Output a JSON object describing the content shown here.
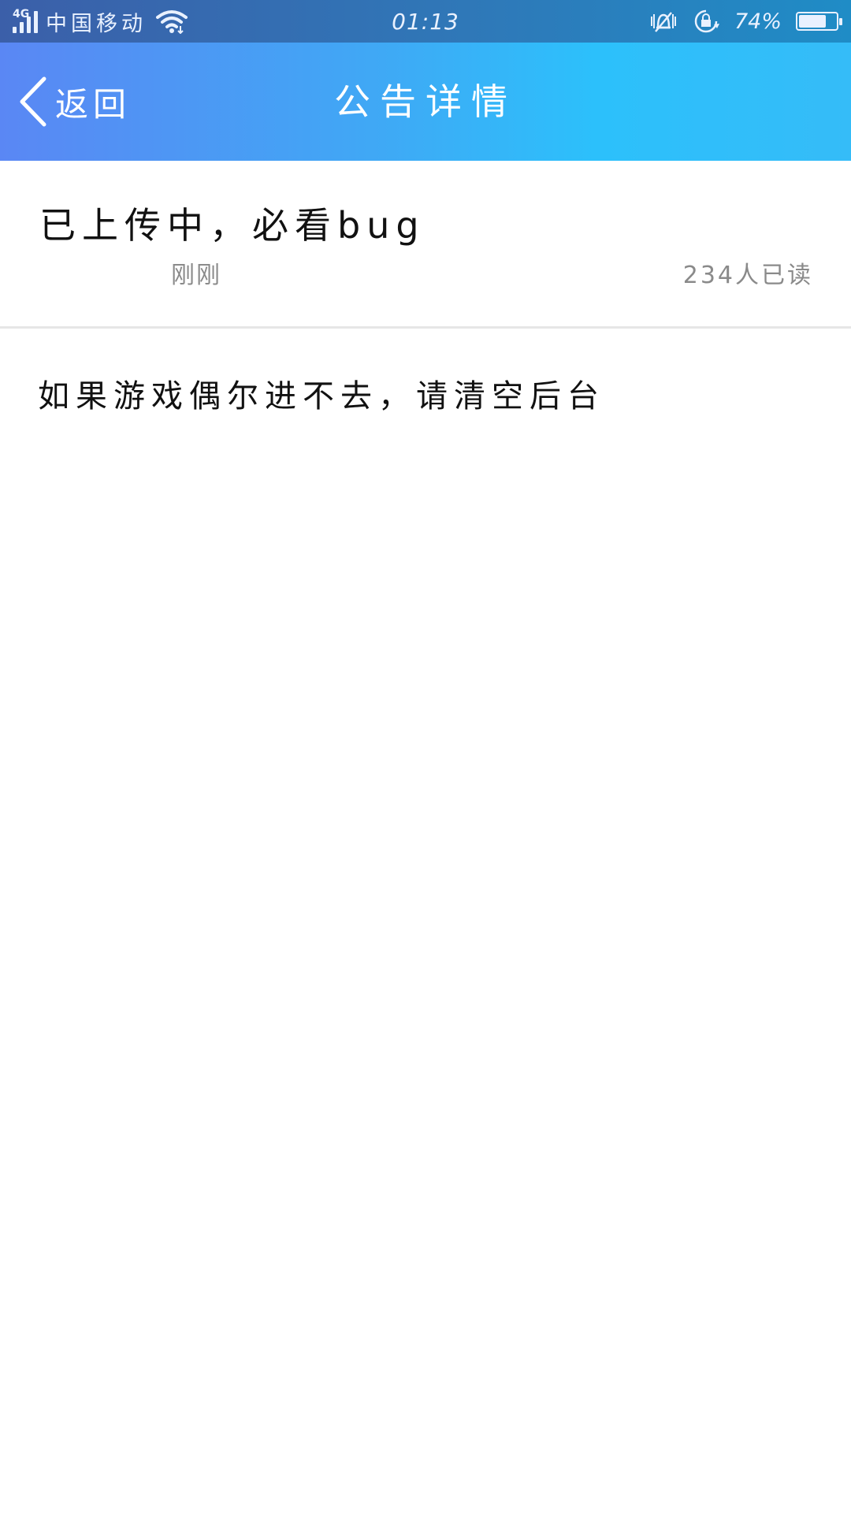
{
  "status_bar": {
    "network_type": "4G",
    "carrier": "中国移动",
    "time": "01:13",
    "battery_percent": "74%",
    "battery_level": 0.74,
    "icons": [
      "signal-icon",
      "wifi-icon",
      "vibrate-mute-icon",
      "rotation-lock-icon",
      "battery-icon"
    ]
  },
  "nav_bar": {
    "back_label": "返回",
    "title": "公告详情",
    "back_icon": "chevron-left-icon"
  },
  "notice": {
    "title": "已上传中，必看bug",
    "time": "刚刚",
    "read_count": "234人已读",
    "body": "如果游戏偶尔进不去，请清空后台"
  },
  "colors": {
    "status_bar": "#2f78b8",
    "nav_gradient_start": "#5a87f4",
    "nav_gradient_end": "#2cc0fb",
    "text_primary": "#111111",
    "text_secondary": "#8a8a8a",
    "divider": "#e6e6e6"
  }
}
